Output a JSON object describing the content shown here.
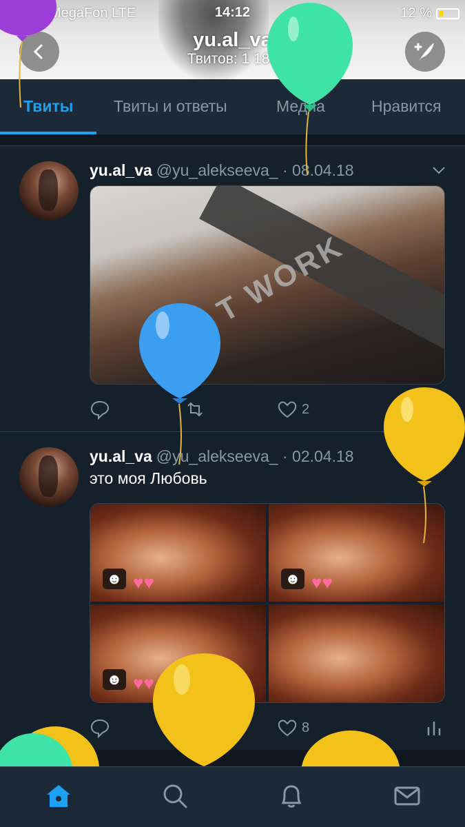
{
  "status_bar": {
    "carrier": "●●●○○ MegaFon  LTE",
    "time": "14:12",
    "battery": "12 %"
  },
  "profile": {
    "name": "yu.al_va",
    "tweet_count": "Твитов: 1 188"
  },
  "tabs": [
    {
      "label": "Твиты",
      "active": true
    },
    {
      "label": "Твиты и ответы",
      "active": false
    },
    {
      "label": "Медиа",
      "active": false
    },
    {
      "label": "Нравится",
      "active": false
    }
  ],
  "tweets": [
    {
      "name": "yu.al_va",
      "meta": "@yu_alekseeva_ · 08.04.18",
      "text": "",
      "image_text": "T WORK",
      "likes": "2",
      "retweets": ""
    },
    {
      "name": "yu.al_va",
      "meta": "@yu_alekseeva_ · 02.04.18",
      "text": "это моя Любовь",
      "likes": "8",
      "retweets": "1"
    }
  ],
  "colors": {
    "accent": "#1da1f2",
    "background": "#15202b",
    "secondary_text": "#8899a6",
    "balloon_purple": "#9b3dd6",
    "balloon_green": "#3fe3a6",
    "balloon_blue": "#3c9ef0",
    "balloon_yellow": "#f3c21a"
  },
  "bottom_nav": [
    "home-icon",
    "search-icon",
    "bell-icon",
    "mail-icon"
  ]
}
